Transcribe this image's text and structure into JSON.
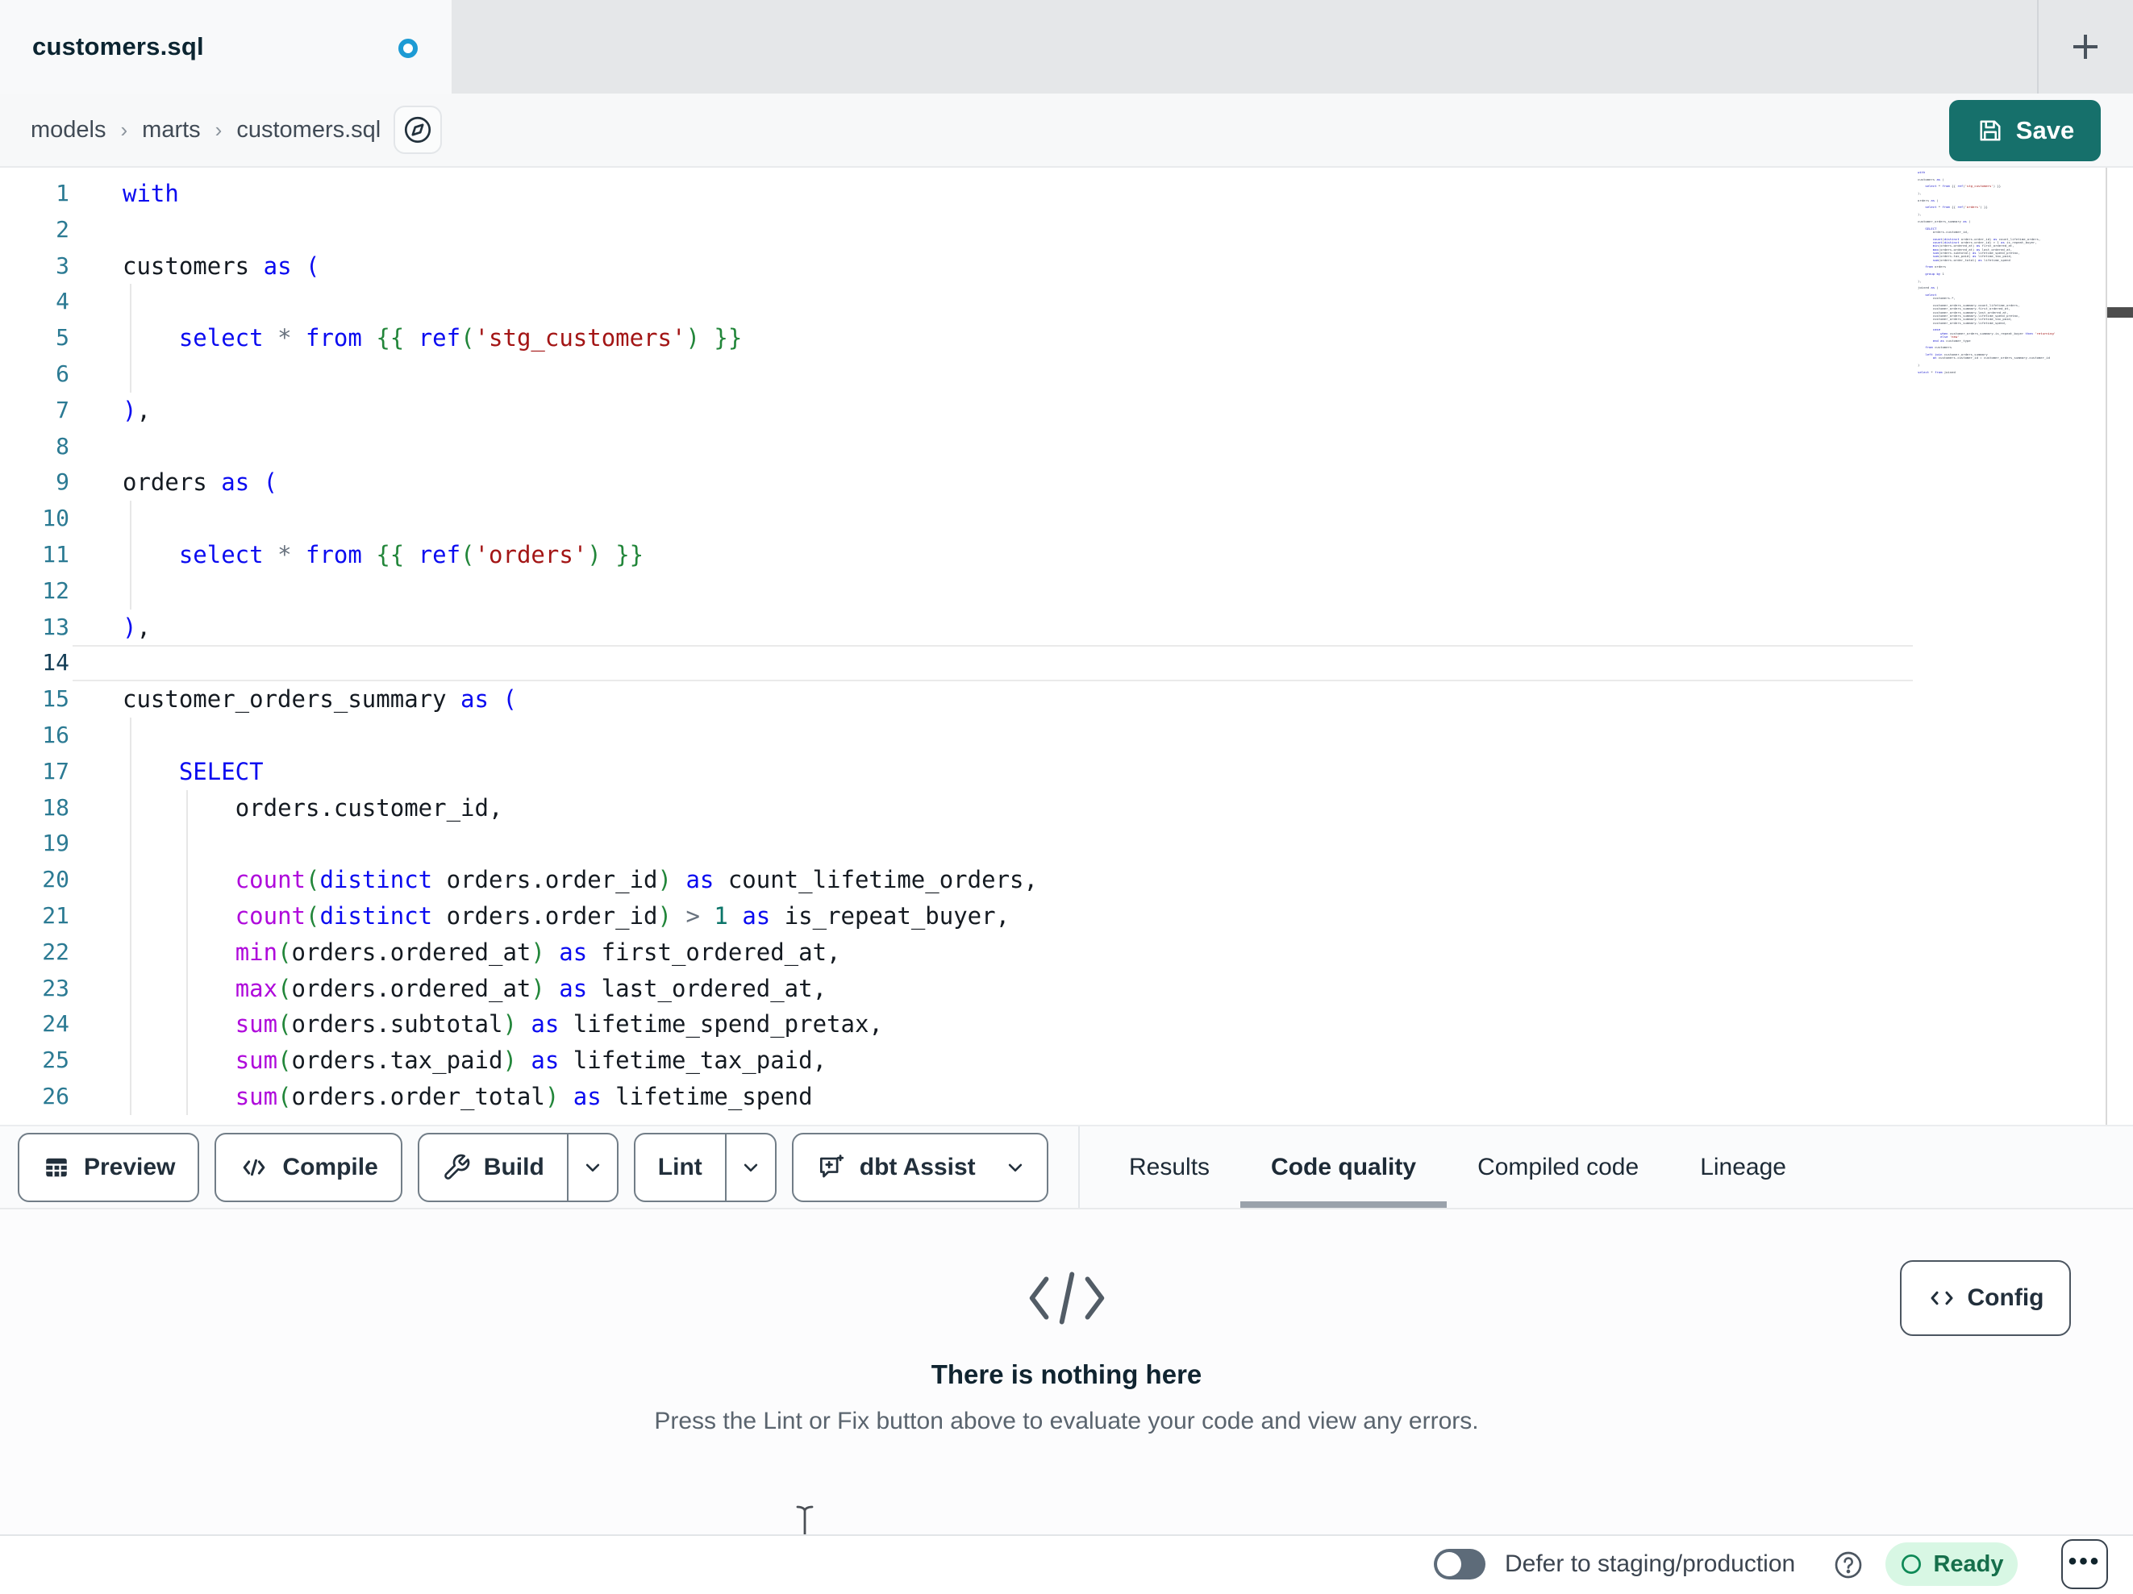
{
  "window": {
    "tab_title": "customers.sql",
    "unsaved_indicator": "blue-dot",
    "new_tab_icon": "plus-icon"
  },
  "breadcrumb": {
    "items": [
      "models",
      "marts",
      "customers.sql"
    ],
    "separator": "›",
    "explore_icon": "compass-icon"
  },
  "save_button": {
    "label": "Save",
    "icon": "floppy-icon",
    "color": "#16706b"
  },
  "editor": {
    "active_line": 14,
    "lines": [
      {
        "n": 1,
        "guides": [],
        "tokens": [
          [
            "with",
            "kw"
          ]
        ]
      },
      {
        "n": 2,
        "guides": [],
        "tokens": []
      },
      {
        "n": 3,
        "guides": [],
        "tokens": [
          [
            "customers",
            "id"
          ],
          [
            " ",
            "id"
          ],
          [
            "as",
            "kw"
          ],
          [
            " ",
            "id"
          ],
          [
            "(",
            "pb"
          ]
        ]
      },
      {
        "n": 4,
        "guides": [
          0
        ],
        "tokens": []
      },
      {
        "n": 5,
        "guides": [
          0
        ],
        "tokens": [
          [
            "    ",
            "id"
          ],
          [
            "select",
            "kw"
          ],
          [
            " ",
            "id"
          ],
          [
            "*",
            "op"
          ],
          [
            " ",
            "id"
          ],
          [
            "from",
            "kw"
          ],
          [
            " ",
            "id"
          ],
          [
            "{{",
            "jinja"
          ],
          [
            " ",
            "id"
          ],
          [
            "ref",
            "kw"
          ],
          [
            "(",
            "pg"
          ],
          [
            "'stg_customers'",
            "str"
          ],
          [
            ")",
            "pg"
          ],
          [
            " ",
            "id"
          ],
          [
            "}}",
            "jinja"
          ]
        ]
      },
      {
        "n": 6,
        "guides": [
          0
        ],
        "tokens": []
      },
      {
        "n": 7,
        "guides": [],
        "tokens": [
          [
            ")",
            "pb"
          ],
          [
            ",",
            "id"
          ]
        ]
      },
      {
        "n": 8,
        "guides": [],
        "tokens": []
      },
      {
        "n": 9,
        "guides": [],
        "tokens": [
          [
            "orders",
            "id"
          ],
          [
            " ",
            "id"
          ],
          [
            "as",
            "kw"
          ],
          [
            " ",
            "id"
          ],
          [
            "(",
            "pb"
          ]
        ]
      },
      {
        "n": 10,
        "guides": [
          0
        ],
        "tokens": []
      },
      {
        "n": 11,
        "guides": [
          0
        ],
        "tokens": [
          [
            "    ",
            "id"
          ],
          [
            "select",
            "kw"
          ],
          [
            " ",
            "id"
          ],
          [
            "*",
            "op"
          ],
          [
            " ",
            "id"
          ],
          [
            "from",
            "kw"
          ],
          [
            " ",
            "id"
          ],
          [
            "{{",
            "jinja"
          ],
          [
            " ",
            "id"
          ],
          [
            "ref",
            "kw"
          ],
          [
            "(",
            "pg"
          ],
          [
            "'orders'",
            "str"
          ],
          [
            ")",
            "pg"
          ],
          [
            " ",
            "id"
          ],
          [
            "}}",
            "jinja"
          ]
        ]
      },
      {
        "n": 12,
        "guides": [
          0
        ],
        "tokens": []
      },
      {
        "n": 13,
        "guides": [],
        "tokens": [
          [
            ")",
            "pb"
          ],
          [
            ",",
            "id"
          ]
        ]
      },
      {
        "n": 14,
        "guides": [],
        "tokens": []
      },
      {
        "n": 15,
        "guides": [],
        "tokens": [
          [
            "customer_orders_summary",
            "id"
          ],
          [
            " ",
            "id"
          ],
          [
            "as",
            "kw"
          ],
          [
            " ",
            "id"
          ],
          [
            "(",
            "pb"
          ]
        ]
      },
      {
        "n": 16,
        "guides": [
          0
        ],
        "tokens": []
      },
      {
        "n": 17,
        "guides": [
          0
        ],
        "tokens": [
          [
            "    ",
            "id"
          ],
          [
            "SELECT",
            "kw"
          ]
        ]
      },
      {
        "n": 18,
        "guides": [
          0,
          4
        ],
        "tokens": [
          [
            "        ",
            "id"
          ],
          [
            "orders.customer_id,",
            "id"
          ]
        ]
      },
      {
        "n": 19,
        "guides": [
          0,
          4
        ],
        "tokens": []
      },
      {
        "n": 20,
        "guides": [
          0,
          4
        ],
        "tokens": [
          [
            "        ",
            "id"
          ],
          [
            "count",
            "fn"
          ],
          [
            "(",
            "pg"
          ],
          [
            "distinct",
            "kw"
          ],
          [
            " orders.order_id",
            "id"
          ],
          [
            ")",
            "pg"
          ],
          [
            " ",
            "id"
          ],
          [
            "as",
            "kw"
          ],
          [
            " count_lifetime_orders,",
            "id"
          ]
        ]
      },
      {
        "n": 21,
        "guides": [
          0,
          4
        ],
        "tokens": [
          [
            "        ",
            "id"
          ],
          [
            "count",
            "fn"
          ],
          [
            "(",
            "pg"
          ],
          [
            "distinct",
            "kw"
          ],
          [
            " orders.order_id",
            "id"
          ],
          [
            ")",
            "pg"
          ],
          [
            " ",
            "id"
          ],
          [
            ">",
            "op"
          ],
          [
            " ",
            "id"
          ],
          [
            "1",
            "num"
          ],
          [
            " ",
            "id"
          ],
          [
            "as",
            "kw"
          ],
          [
            " is_repeat_buyer,",
            "id"
          ]
        ]
      },
      {
        "n": 22,
        "guides": [
          0,
          4
        ],
        "tokens": [
          [
            "        ",
            "id"
          ],
          [
            "min",
            "fn"
          ],
          [
            "(",
            "pg"
          ],
          [
            "orders.ordered_at",
            "id"
          ],
          [
            ")",
            "pg"
          ],
          [
            " ",
            "id"
          ],
          [
            "as",
            "kw"
          ],
          [
            " first_ordered_at,",
            "id"
          ]
        ]
      },
      {
        "n": 23,
        "guides": [
          0,
          4
        ],
        "tokens": [
          [
            "        ",
            "id"
          ],
          [
            "max",
            "fn"
          ],
          [
            "(",
            "pg"
          ],
          [
            "orders.ordered_at",
            "id"
          ],
          [
            ")",
            "pg"
          ],
          [
            " ",
            "id"
          ],
          [
            "as",
            "kw"
          ],
          [
            " last_ordered_at,",
            "id"
          ]
        ]
      },
      {
        "n": 24,
        "guides": [
          0,
          4
        ],
        "tokens": [
          [
            "        ",
            "id"
          ],
          [
            "sum",
            "fn"
          ],
          [
            "(",
            "pg"
          ],
          [
            "orders.subtotal",
            "id"
          ],
          [
            ")",
            "pg"
          ],
          [
            " ",
            "id"
          ],
          [
            "as",
            "kw"
          ],
          [
            " lifetime_spend_pretax,",
            "id"
          ]
        ]
      },
      {
        "n": 25,
        "guides": [
          0,
          4
        ],
        "tokens": [
          [
            "        ",
            "id"
          ],
          [
            "sum",
            "fn"
          ],
          [
            "(",
            "pg"
          ],
          [
            "orders.tax_paid",
            "id"
          ],
          [
            ")",
            "pg"
          ],
          [
            " ",
            "id"
          ],
          [
            "as",
            "kw"
          ],
          [
            " lifetime_tax_paid,",
            "id"
          ]
        ]
      },
      {
        "n": 26,
        "guides": [
          0,
          4
        ],
        "tokens": [
          [
            "        ",
            "id"
          ],
          [
            "sum",
            "fn"
          ],
          [
            "(",
            "pg"
          ],
          [
            "orders.order_total",
            "id"
          ],
          [
            ")",
            "pg"
          ],
          [
            " ",
            "id"
          ],
          [
            "as",
            "kw"
          ],
          [
            " lifetime_spend",
            "id"
          ]
        ]
      }
    ],
    "minimap_lines": [
      "with",
      "",
      "customers as (",
      "",
      "    select * from {{ ref('stg_customers') }}",
      "",
      "),",
      "",
      "orders as (",
      "",
      "    select * from {{ ref('orders') }}",
      "",
      "),",
      "",
      "customer_orders_summary as (",
      "",
      "    SELECT",
      "        orders.customer_id,",
      "",
      "        count(distinct orders.order_id) as count_lifetime_orders,",
      "        count(distinct orders.order_id) > 1 as is_repeat_buyer,",
      "        min(orders.ordered_at) as first_ordered_at,",
      "        max(orders.ordered_at) as last_ordered_at,",
      "        sum(orders.subtotal) as lifetime_spend_pretax,",
      "        sum(orders.tax_paid) as lifetime_tax_paid,",
      "        sum(orders.order_total) as lifetime_spend",
      "",
      "    from orders",
      "",
      "    group by 1",
      "",
      "),",
      "",
      "joined as (",
      "",
      "    select",
      "        customers.*,",
      "",
      "        customer_orders_summary.count_lifetime_orders,",
      "        customer_orders_summary.first_ordered_at,",
      "        customer_orders_summary.last_ordered_at,",
      "        customer_orders_summary.lifetime_spend_pretax,",
      "        customer_orders_summary.lifetime_tax_paid,",
      "        customer_orders_summary.lifetime_spend,",
      "",
      "        case",
      "            when customer_orders_summary.is_repeat_buyer then 'returning'",
      "            else 'new'",
      "        end as customer_type",
      "",
      "    from customers",
      "",
      "    left join customer_orders_summary",
      "        on customers.customer_id = customer_orders_summary.customer_id",
      "",
      ")",
      "",
      "select * from joined"
    ]
  },
  "toolbar": {
    "buttons": [
      {
        "id": "preview",
        "label": "Preview",
        "icon": "table-icon"
      },
      {
        "id": "compile",
        "label": "Compile",
        "icon": "code-icon"
      },
      {
        "id": "build",
        "label": "Build",
        "icon": "wrench-icon",
        "split": true
      },
      {
        "id": "lint",
        "label": "Lint",
        "split": true
      },
      {
        "id": "dbt-assist",
        "label": "dbt Assist",
        "icon": "chat-sparkle-icon",
        "chevron": true
      }
    ]
  },
  "result_tabs": [
    {
      "label": "Results",
      "active": false
    },
    {
      "label": "Code quality",
      "active": true
    },
    {
      "label": "Compiled code",
      "active": false
    },
    {
      "label": "Lineage",
      "active": false
    }
  ],
  "panel": {
    "icon": "code-slash-icon",
    "title": "There is nothing here",
    "description": "Press the Lint or Fix button above to evaluate your code and view any errors.",
    "config_label": "Config",
    "config_icon": "code-icon"
  },
  "statusbar": {
    "defer_label": "Defer to staging/production",
    "defer_on": false,
    "help_icon": "question-icon",
    "status_label": "Ready",
    "status_icon": "circle-icon",
    "more_icon": "ellipsis-icon"
  },
  "colors": {
    "accent_teal": "#16706b",
    "unsaved_dot_blue": "#1d9bd4",
    "tabbar_bg": "#e5e7e9",
    "ready_bg": "#d8f7e4",
    "ready_text": "#166f4b",
    "syntax_keyword": "#0b0bf0",
    "syntax_function": "#af0adb",
    "syntax_string": "#a31515",
    "syntax_jinja": "#22863a",
    "syntax_number": "#0b7569",
    "syntax_operator": "#68727e",
    "line_number": "#2b7a93"
  }
}
